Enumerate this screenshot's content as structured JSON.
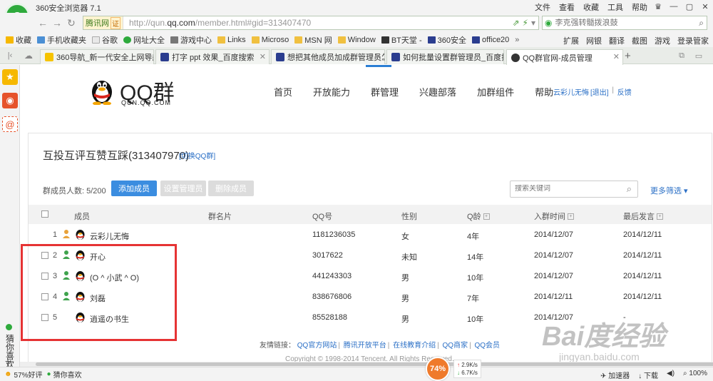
{
  "browser": {
    "title": "360安全浏览器 7.1",
    "menu": [
      "文件",
      "查看",
      "收藏",
      "工具",
      "帮助"
    ],
    "site_tag": "腾讯网",
    "cert": "证",
    "url_prefix": "http://qun.",
    "url_domain": "qq.com",
    "url_suffix": "/member.html#gid=313407470",
    "search_placeholder": "李克强转髓拨浪鼓",
    "bookmarks": [
      "收藏",
      "手机收藏夹",
      "谷歌",
      "网址大全",
      "游戏中心",
      "Links",
      "Microso",
      "MSN 网",
      "Window",
      "BT天堂 -",
      "360安全",
      "office20"
    ],
    "bookmarks_right": [
      "扩展",
      "网银",
      "翻译",
      "截图",
      "游戏",
      "登录管家"
    ],
    "tabs": [
      {
        "label": "360导航_新一代安全上网导航"
      },
      {
        "label": "打字 ppt 效果_百度搜索"
      },
      {
        "label": "想把其他成员加成群管理员怎么"
      },
      {
        "label": "如何批量设置群管理员_百度搜索"
      },
      {
        "label": "QQ群官网-成员管理"
      }
    ],
    "sidebar_text": "猜你喜欢",
    "status": {
      "rating": "57%好评",
      "guess": "猜你喜欢",
      "speed_percent": "74%",
      "up": "2.9K/s",
      "down": "6.7K/s",
      "accelerator": "加速器",
      "download": "下载",
      "zoom": "100%"
    }
  },
  "qq": {
    "brand": "QQ群",
    "domain": "QUN.QQ.COM",
    "nav": [
      "首页",
      "开放能力",
      "群管理",
      "兴趣部落",
      "加群组件",
      "帮助"
    ],
    "user": "云彩儿无悔",
    "logout": "[退出]",
    "feedback": "反馈",
    "group_title": "互投互评互赞互踩(313407970)",
    "switch_link": "[切换QQ群]",
    "member_count": "群成员人数: 5/200",
    "btn_add": "添加成员",
    "btn_set_admin": "设置管理员",
    "btn_delete": "删除成员",
    "search_placeholder": "搜索关键词",
    "more_filter": "更多筛选 ▾",
    "columns": [
      "成员",
      "群名片",
      "QQ号",
      "性别",
      "Q龄",
      "入群时间",
      "最后发言"
    ],
    "rows": [
      {
        "idx": "1",
        "name": "云彩儿无悔",
        "qq": "1181236035",
        "gender": "女",
        "age": "4年",
        "join": "2014/12/07",
        "last": "2014/12/11",
        "role": "owner"
      },
      {
        "idx": "2",
        "name": "开心",
        "qq": "3017622",
        "gender": "未知",
        "age": "14年",
        "join": "2014/12/07",
        "last": "2014/12/11",
        "role": "member"
      },
      {
        "idx": "3",
        "name": "(O ^ 小武 ^ O)",
        "qq": "441243303",
        "gender": "男",
        "age": "10年",
        "join": "2014/12/07",
        "last": "2014/12/11",
        "role": "member"
      },
      {
        "idx": "4",
        "name": "刘磊",
        "qq": "838676806",
        "gender": "男",
        "age": "7年",
        "join": "2014/12/11",
        "last": "2014/12/11",
        "role": "member"
      },
      {
        "idx": "5",
        "name": "逍遥の书生",
        "qq": "85528188",
        "gender": "男",
        "age": "10年",
        "join": "2014/12/07",
        "last": "-",
        "role": "none"
      }
    ],
    "footer_label": "友情链接：",
    "footer_links": [
      "QQ官方网站",
      "腾讯开放平台",
      "在线教育介绍",
      "QQ商家",
      "QQ会员"
    ],
    "copyright": "Copyright © 1998-2014 Tencent. All Rights Reserved."
  },
  "watermark": {
    "main": "Bai度经验",
    "sub": "jingyan.baidu.com"
  },
  "colors": {
    "accent": "#3b8de0",
    "highlight": "#e63334",
    "browser_green": "#2eaa3c"
  }
}
